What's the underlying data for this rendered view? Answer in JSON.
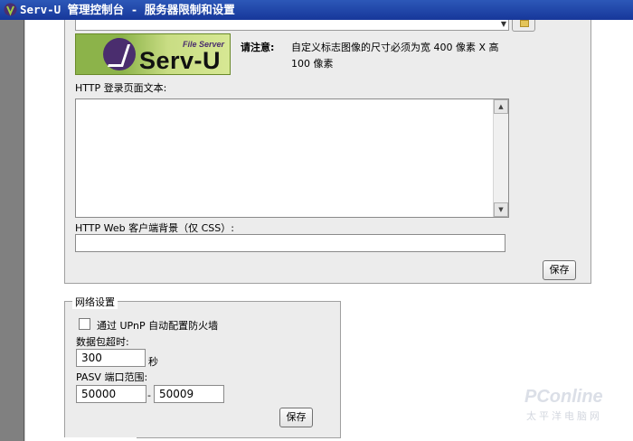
{
  "window": {
    "title": "Serv-U 管理控制台 - 服务器限制和设置"
  },
  "logo": {
    "brand": "Serv-U",
    "subtitle": "File Server"
  },
  "note": {
    "label": "请注意:",
    "text": "自定义标志图像的尺寸必须为宽 400 像素 X 高 100 像素"
  },
  "http_login": {
    "label": "HTTP 登录页面文本:",
    "value": ""
  },
  "http_css": {
    "label": "HTTP Web 客户端背景（仅 CSS）:",
    "value": ""
  },
  "save_top": {
    "label": "保存"
  },
  "network": {
    "legend": "网络设置",
    "upnp_label": "通过 UPnP 自动配置防火墙",
    "upnp_checked": false,
    "timeout_label": "数据包超时:",
    "timeout_value": "300",
    "timeout_unit": "秒",
    "pasv_label": "PASV 端口范围:",
    "pasv_from": "50000",
    "pasv_dash": "-",
    "pasv_to": "50009",
    "save_label": "保存"
  },
  "watermark": {
    "main": "PConline",
    "sub": "太平洋电脑网"
  },
  "icons": [
    "app-icon",
    "browse-folder-icon",
    "scroll-up-icon",
    "scroll-down-icon",
    "checkbox-icon"
  ]
}
